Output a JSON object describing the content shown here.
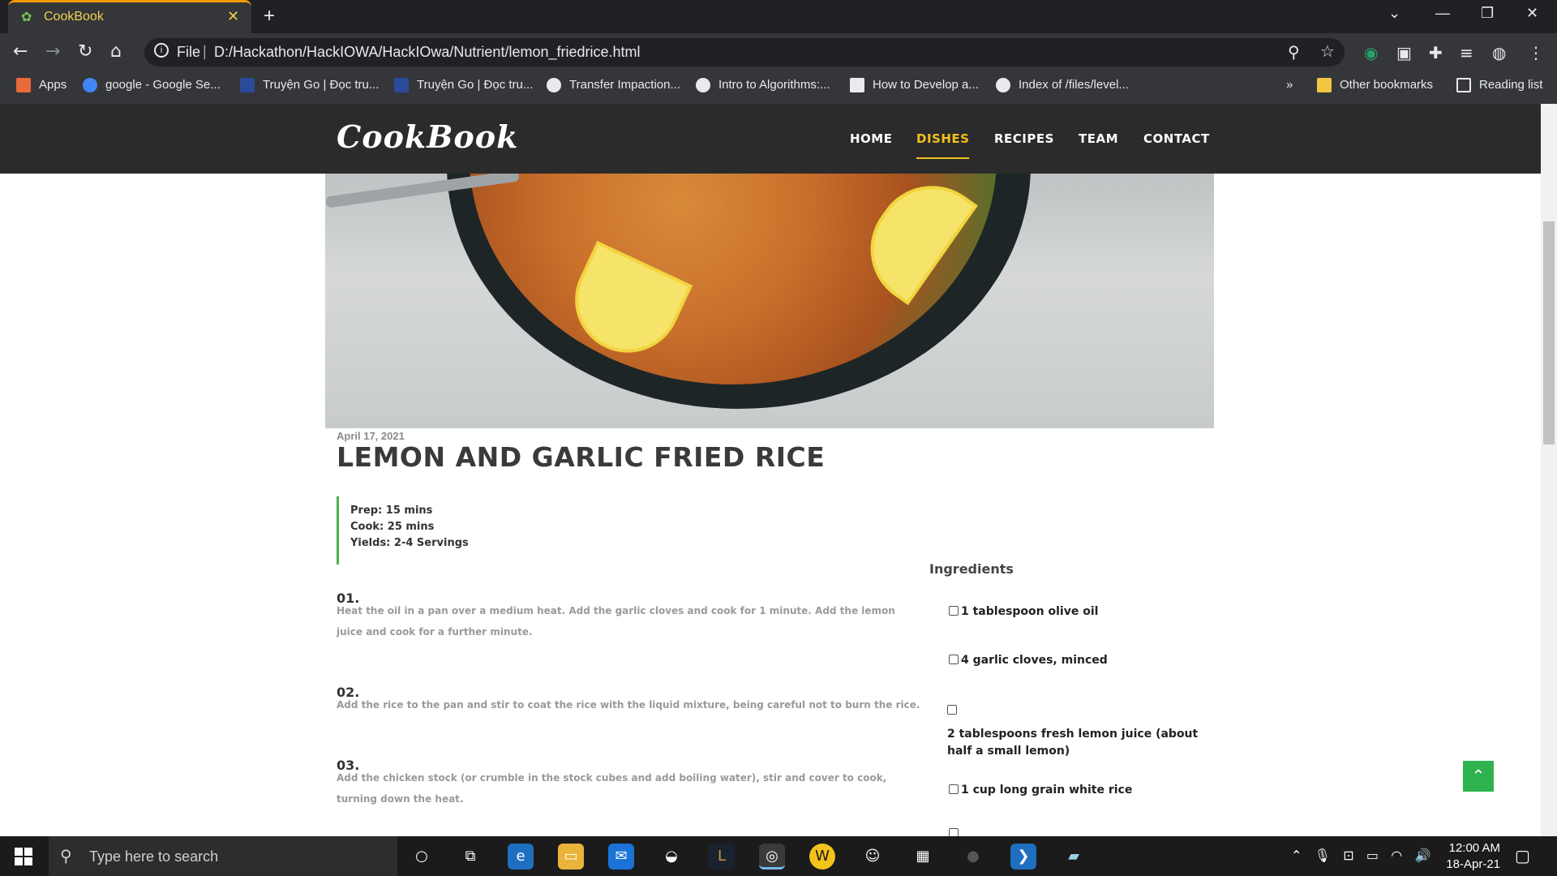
{
  "browser": {
    "tab_title": "CookBook",
    "address_scheme": "File",
    "address_url": "D:/Hackathon/HackIOWA/HackIOwa/Nutrient/lemon_friedrice.html",
    "bookmarks": [
      "Apps",
      "google - Google Se...",
      "Truyện Go | Đọc tru...",
      "Truyện Go | Đọc tru...",
      "Transfer Impaction...",
      "Intro to Algorithms:...",
      "How to Develop a...",
      "Index of /files/level...",
      "»",
      "Other bookmarks",
      "Reading list"
    ]
  },
  "site": {
    "logo": "CookBook",
    "nav": [
      "HOME",
      "DISHES",
      "RECIPES",
      "TEAM",
      "CONTACT"
    ],
    "active_nav": "DISHES"
  },
  "recipe": {
    "date": "April 17, 2021",
    "title": "LEMON AND GARLIC FRIED RICE",
    "prep": "Prep: 15 mins",
    "cook": "Cook: 25 mins",
    "yields": "Yields: 2-4 Servings",
    "steps": [
      {
        "num": "01.",
        "text": "Heat the oil in a pan over a medium heat. Add the garlic cloves and cook for 1 minute. Add the lemon juice and cook for a further minute."
      },
      {
        "num": "02.",
        "text": "Add the rice to the pan and stir to coat the rice with the liquid mixture, being careful not to burn the rice."
      },
      {
        "num": "03.",
        "text": "Add the chicken stock (or crumble in the stock cubes and add boiling water), stir and cover to cook, turning down the heat."
      }
    ],
    "ingredients_heading": "Ingredients",
    "ingredients": [
      "1 tablespoon olive oil",
      "4 garlic cloves, minced",
      "2 tablespoons fresh lemon juice (about half a small lemon)",
      "1 cup long grain white rice"
    ]
  },
  "taskbar": {
    "search_placeholder": "Type here to search",
    "time": "12:00 AM",
    "date": "18-Apr-21"
  },
  "colors": {
    "accent_active_nav": "#f2c01d",
    "meta_border": "#4caf50",
    "to_top_button": "#2fb34e",
    "tab_title": "#f1d04e"
  }
}
